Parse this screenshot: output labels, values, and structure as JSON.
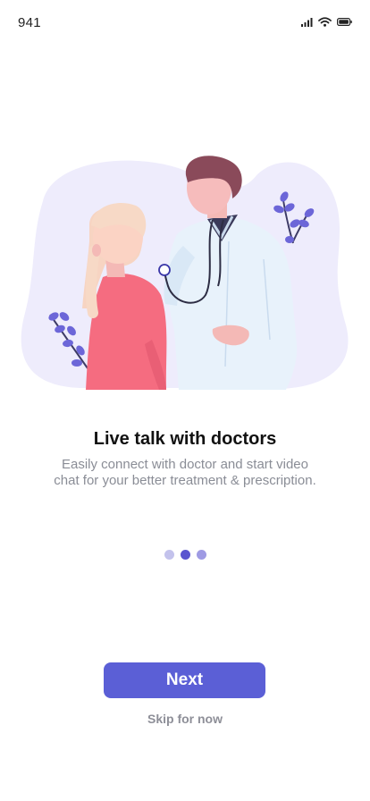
{
  "status_bar": {
    "time": "941"
  },
  "onboarding": {
    "title": "Live talk with doctors",
    "subtitle": "Easily connect with doctor and start video chat for your better treatment & prescription.",
    "current_page": 2,
    "total_pages": 3
  },
  "actions": {
    "next_label": "Next",
    "skip_label": "Skip for now"
  },
  "colors": {
    "accent": "#5b5fd6",
    "blob": "#eeecfc",
    "dot_active": "#5a55cf",
    "dot_inactive": "#c3c2ec"
  },
  "icons": [
    "signal-icon",
    "wifi-icon",
    "battery-icon",
    "doctor-patient-illustration"
  ]
}
